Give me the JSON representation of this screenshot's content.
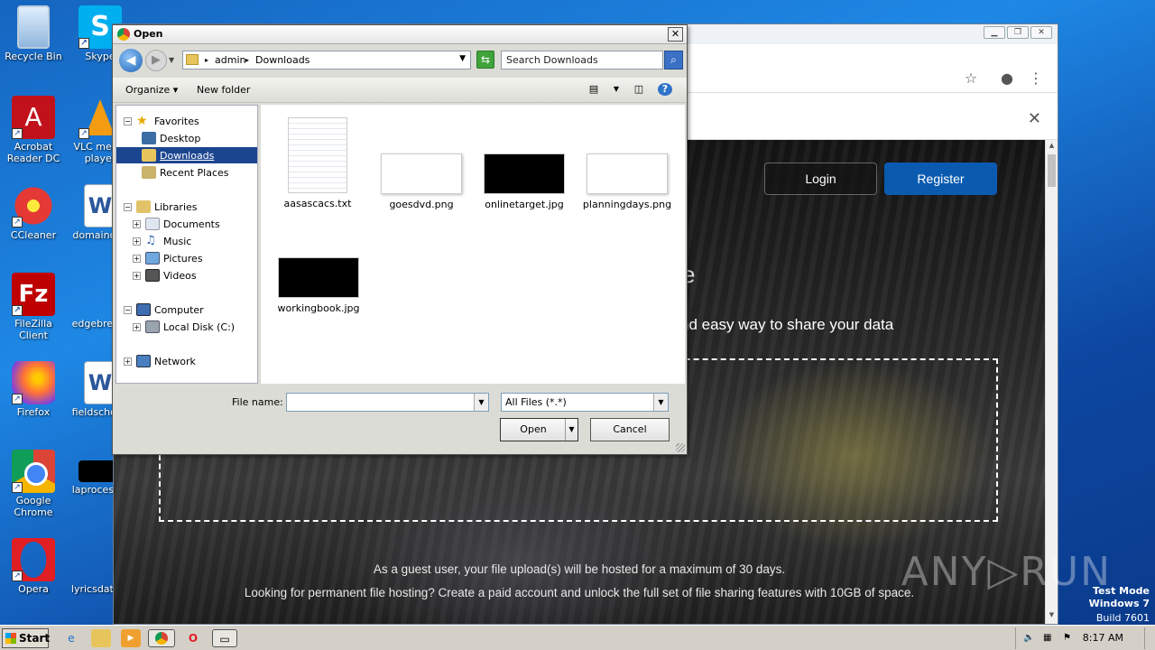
{
  "desktop": {
    "icons": [
      {
        "label": "Recycle Bin"
      },
      {
        "label": "Skype"
      },
      {
        "label": "Acrobat Reader DC"
      },
      {
        "label": "VLC media player"
      },
      {
        "label": "CCleaner"
      },
      {
        "label": "domaincr..."
      },
      {
        "label": "FileZilla Client"
      },
      {
        "label": "edgebrea..."
      },
      {
        "label": "Firefox"
      },
      {
        "label": "fieldschoi..."
      },
      {
        "label": "Google Chrome"
      },
      {
        "label": "laprocess..."
      },
      {
        "label": "Opera"
      },
      {
        "label": "lyricsdate..."
      }
    ]
  },
  "browser": {
    "login_label": "Login",
    "register_label": "Register",
    "heading_fragment": "e",
    "tagline": "nd easy way to share your data",
    "info_line1": "As a guest user, your file upload(s) will be hosted for a maximum of 30 days.",
    "info_line2": "Looking for permanent file hosting? Create a paid account and unlock the full set of file sharing features with 10GB of space.",
    "notice_close": "✕"
  },
  "dialog": {
    "title": "Open",
    "path": [
      "admin",
      "Downloads"
    ],
    "search_placeholder": "Search Downloads",
    "organize_label": "Organize ▾",
    "new_folder_label": "New folder",
    "tree": {
      "favorites": "Favorites",
      "desktop": "Desktop",
      "downloads": "Downloads",
      "recent": "Recent Places",
      "libraries": "Libraries",
      "documents": "Documents",
      "music": "Music",
      "pictures": "Pictures",
      "videos": "Videos",
      "computer": "Computer",
      "local_disk": "Local Disk (C:)",
      "network": "Network"
    },
    "files": [
      {
        "name": "aasascacs.txt",
        "kind": "text"
      },
      {
        "name": "goesdvd.png",
        "kind": "white-image"
      },
      {
        "name": "onlinetarget.jpg",
        "kind": "black-image"
      },
      {
        "name": "planningdays.png",
        "kind": "white-image"
      },
      {
        "name": "workingbook.jpg",
        "kind": "black-image"
      }
    ],
    "file_name_label": "File name:",
    "file_name_value": "",
    "file_type": "All Files (*.*)",
    "open_label": "Open",
    "cancel_label": "Cancel"
  },
  "taskbar": {
    "start_label": "Start",
    "clock": "8:17 AM"
  },
  "watermark": {
    "brand": "ANY▷RUN",
    "test_mode": "Test Mode",
    "os": "Windows 7",
    "build": "Build 7601"
  }
}
